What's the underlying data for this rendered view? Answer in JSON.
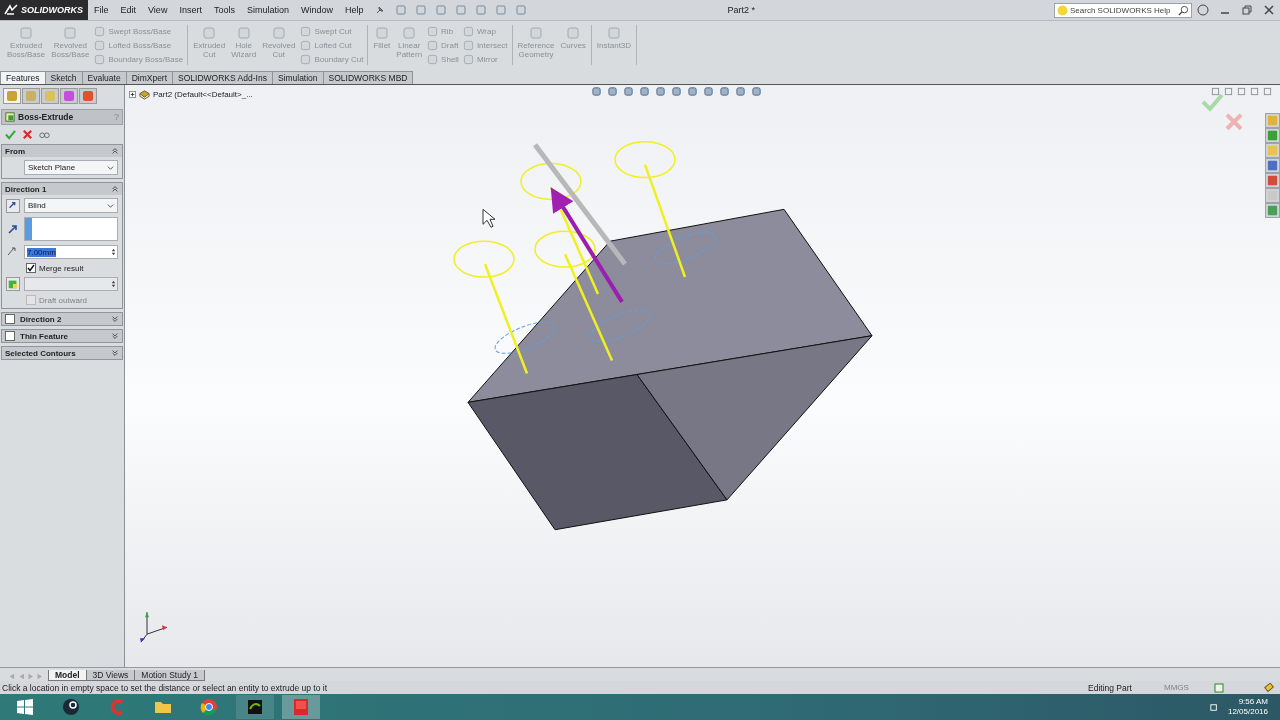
{
  "title_bar": {
    "app_name": "SOLIDWORKS",
    "menu": [
      "File",
      "Edit",
      "View",
      "Insert",
      "Tools",
      "Simulation",
      "Window",
      "Help"
    ],
    "document_title": "Part2 *",
    "search": {
      "placeholder": "Search SOLIDWORKS Help"
    }
  },
  "ribbon": {
    "disabled": true,
    "groups": [
      {
        "columns": [
          {
            "kind": "large",
            "labels": [
              "Extruded Boss/Base"
            ]
          },
          {
            "kind": "large",
            "labels": [
              "Revolved Boss/Base"
            ]
          },
          {
            "kind": "stack",
            "labels": [
              "Swept Boss/Base",
              "Lofted Boss/Base",
              "Boundary Boss/Base"
            ]
          }
        ]
      },
      {
        "columns": [
          {
            "kind": "large",
            "labels": [
              "Extruded Cut"
            ]
          },
          {
            "kind": "large",
            "labels": [
              "Hole Wizard"
            ]
          },
          {
            "kind": "large",
            "labels": [
              "Revolved Cut"
            ]
          },
          {
            "kind": "stack",
            "labels": [
              "Swept Cut",
              "Lofted Cut",
              "Boundary Cut"
            ]
          }
        ]
      },
      {
        "columns": [
          {
            "kind": "large",
            "labels": [
              "Fillet"
            ]
          },
          {
            "kind": "large",
            "labels": [
              "Linear Pattern"
            ]
          },
          {
            "kind": "stack",
            "labels": [
              "Rib",
              "Draft",
              "Shell"
            ]
          },
          {
            "kind": "stack",
            "labels": [
              "Wrap",
              "Intersect",
              "Mirror"
            ]
          }
        ]
      },
      {
        "columns": [
          {
            "kind": "large",
            "labels": [
              "Reference Geometry"
            ]
          },
          {
            "kind": "large",
            "labels": [
              "Curves"
            ]
          }
        ]
      },
      {
        "columns": [
          {
            "kind": "large",
            "labels": [
              "Instant3D"
            ]
          }
        ]
      }
    ]
  },
  "command_tabs": [
    {
      "label": "Features",
      "selected": true
    },
    {
      "label": "Sketch",
      "selected": false
    },
    {
      "label": "Evaluate",
      "selected": false
    },
    {
      "label": "DimXpert",
      "selected": false
    },
    {
      "label": "SOLIDWORKS Add-Ins",
      "selected": false
    },
    {
      "label": "Simulation",
      "selected": false
    },
    {
      "label": "SOLIDWORKS MBD",
      "selected": false
    }
  ],
  "property_manager": {
    "title": "Boss-Extrude",
    "help": "?",
    "from": {
      "title": "From",
      "expanded": true,
      "start": "Sketch Plane"
    },
    "direction_1": {
      "title": "Direction 1",
      "expanded": true,
      "end_condition": "Blind",
      "depth": "7.00mm",
      "merge_result": {
        "label": "Merge result",
        "checked": true
      },
      "draft_outward": {
        "label": "Draft outward",
        "checked": false,
        "disabled": true
      }
    },
    "collapsed_sections": [
      {
        "kind": "checkbox",
        "title": "Direction 2",
        "checked": false,
        "expanded": false
      },
      {
        "kind": "checkbox",
        "title": "Thin Feature",
        "checked": false,
        "expanded": false
      },
      {
        "kind": "plain",
        "title": "Selected Contours",
        "expanded": false
      }
    ]
  },
  "feature_tree": {
    "label": "Part2  (Default<<Default>_..."
  },
  "bottom_tabs": [
    {
      "label": "Model",
      "selected": true
    },
    {
      "label": "3D Views",
      "selected": false
    },
    {
      "label": "Motion Study 1",
      "selected": false
    }
  ],
  "status_bar": {
    "message": "Click a location in empty space to set the distance or select an entity to extrude up to it",
    "mode": "Editing Part",
    "units": "MMGS"
  },
  "taskbar": {
    "time": "9:56 AM",
    "date": "12/05/2016"
  }
}
